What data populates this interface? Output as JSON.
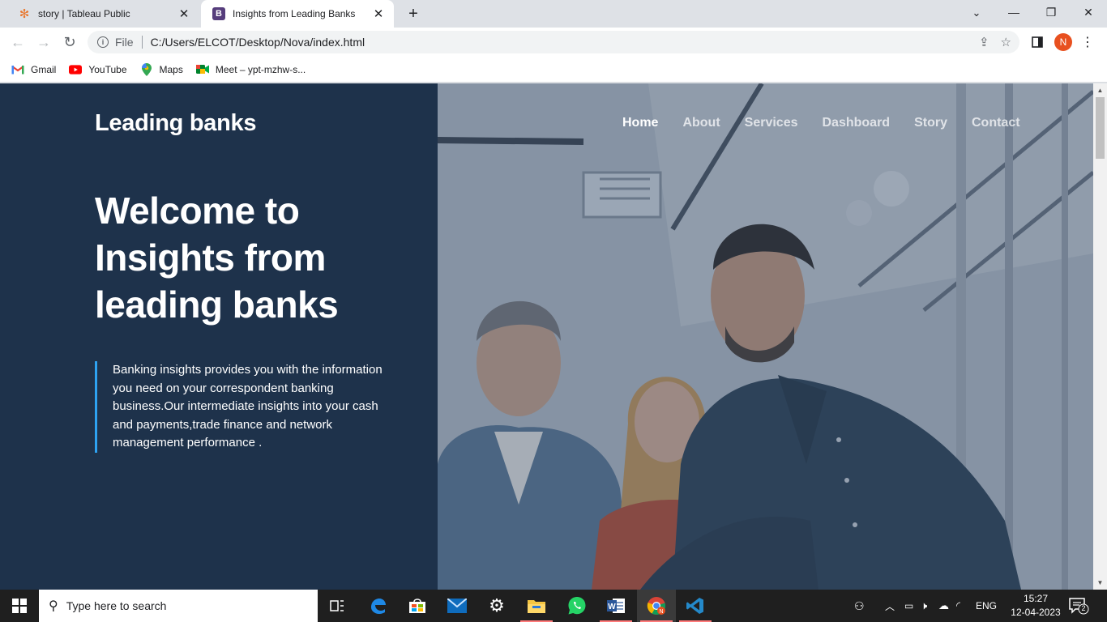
{
  "browser": {
    "tabs": [
      {
        "title": "story | Tableau Public",
        "icon": "tableau-icon",
        "active": false
      },
      {
        "title": "Insights from Leading Banks",
        "icon": "bootstrap-icon",
        "active": true
      }
    ],
    "address": {
      "scheme": "File",
      "url": "C:/Users/ELCOT/Desktop/Nova/index.html"
    },
    "profile_initial": "N",
    "bookmarks": [
      {
        "label": "Gmail",
        "icon": "gmail-icon"
      },
      {
        "label": "YouTube",
        "icon": "youtube-icon"
      },
      {
        "label": "Maps",
        "icon": "maps-icon"
      },
      {
        "label": "Meet – ypt-mzhw-s...",
        "icon": "meet-icon"
      }
    ]
  },
  "page": {
    "brand": "Leading banks",
    "nav": [
      {
        "label": "Home",
        "active": true
      },
      {
        "label": "About",
        "active": false
      },
      {
        "label": "Services",
        "active": false
      },
      {
        "label": "Dashboard",
        "active": false
      },
      {
        "label": "Story",
        "active": false
      },
      {
        "label": "Contact",
        "active": false
      }
    ],
    "hero_title_lines": [
      "Welcome to",
      "Insights from",
      "leading banks"
    ],
    "hero_text": "Banking insights provides you with the information you need on your correspondent banking business.Our intermediate insights into your cash and payments,trade finance and network management performance .",
    "hero_image": "team-of-three-people-photo",
    "colors": {
      "left_panel": "#1e324b",
      "accent": "#2ea3f2"
    }
  },
  "taskbar": {
    "search_placeholder": "Type here to search",
    "language": "ENG",
    "time": "15:27",
    "date": "12-04-2023",
    "notifications": "2"
  }
}
